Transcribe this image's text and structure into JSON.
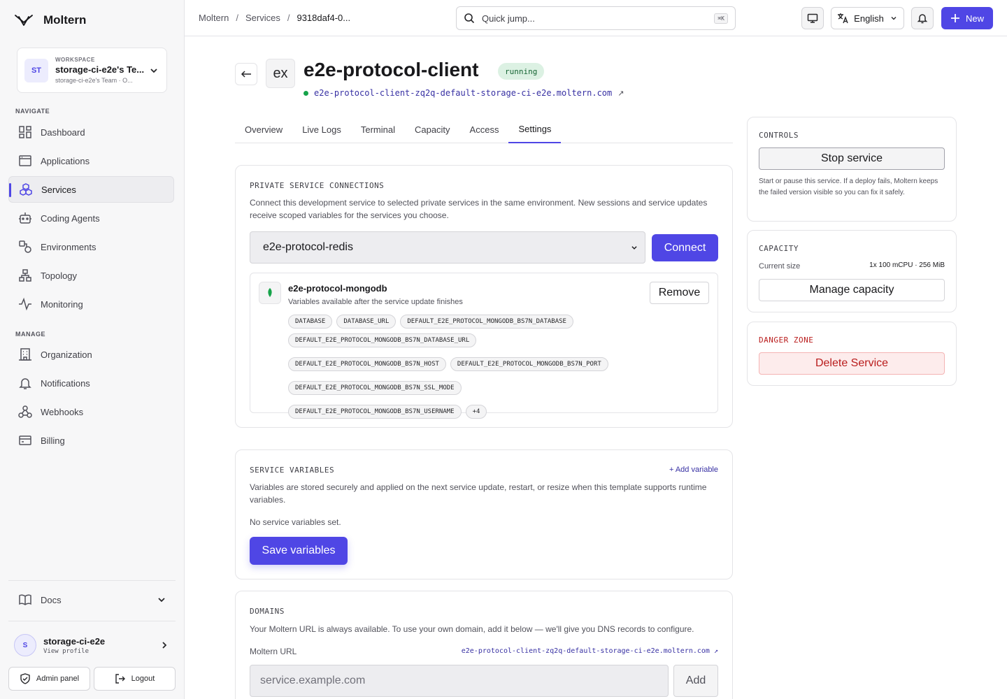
{
  "brand": {
    "name": "Moltern"
  },
  "workspace": {
    "kicker": "WORKSPACE",
    "initials": "ST",
    "name": "storage-ci-e2e's Te...",
    "sub": "storage-ci-e2e's Team · O..."
  },
  "nav": {
    "navigate_label": "NAVIGATE",
    "manage_label": "MANAGE",
    "items": [
      {
        "label": "Dashboard"
      },
      {
        "label": "Applications"
      },
      {
        "label": "Services"
      },
      {
        "label": "Coding Agents"
      },
      {
        "label": "Environments"
      },
      {
        "label": "Topology"
      },
      {
        "label": "Monitoring"
      }
    ],
    "manage_items": [
      {
        "label": "Organization"
      },
      {
        "label": "Notifications"
      },
      {
        "label": "Webhooks"
      },
      {
        "label": "Billing"
      }
    ],
    "docs_label": "Docs"
  },
  "user": {
    "initial": "S",
    "name": "storage-ci-e2e",
    "sub": "View profile"
  },
  "footer": {
    "admin_label": "Admin panel",
    "logout_label": "Logout"
  },
  "topbar": {
    "crumbs": [
      "Moltern",
      "Services",
      "9318daf4-0..."
    ],
    "search_placeholder": "Quick jump...",
    "search_kbd": "⌘K",
    "language": "English",
    "new_label": "New"
  },
  "header": {
    "icon_text": "ex",
    "title": "e2e-protocol-client",
    "status": "running",
    "url": "e2e-protocol-client-zq2q-default-storage-ci-e2e.moltern.com",
    "ext_arrow": "↗"
  },
  "tabs": [
    "Overview",
    "Live Logs",
    "Terminal",
    "Capacity",
    "Access",
    "Settings"
  ],
  "private_connections": {
    "label": "PRIVATE SERVICE CONNECTIONS",
    "desc": "Connect this development service to selected private services in the same environment. New sessions and service updates receive scoped variables for the services you choose.",
    "selected": "e2e-protocol-redis",
    "connect_label": "Connect",
    "item": {
      "name": "e2e-protocol-mongodb",
      "sub": "Variables available after the service update finishes",
      "remove_label": "Remove",
      "vars": [
        "DATABASE",
        "DATABASE_URL",
        "DEFAULT_E2E_PROTOCOL_MONGODB_BS7N_DATABASE",
        "DEFAULT_E2E_PROTOCOL_MONGODB_BS7N_DATABASE_URL",
        "DEFAULT_E2E_PROTOCOL_MONGODB_BS7N_HOST",
        "DEFAULT_E2E_PROTOCOL_MONGODB_BS7N_PORT",
        "DEFAULT_E2E_PROTOCOL_MONGODB_BS7N_SSL_MODE",
        "DEFAULT_E2E_PROTOCOL_MONGODB_BS7N_USERNAME",
        "+4"
      ]
    }
  },
  "service_variables": {
    "label": "SERVICE VARIABLES",
    "add_label": "+ Add variable",
    "desc": "Variables are stored securely and applied on the next service update, restart, or resize when this template supports runtime variables.",
    "empty": "No service variables set.",
    "save_label": "Save variables"
  },
  "domains": {
    "label": "DOMAINS",
    "desc": "Your Moltern URL is always available. To use your own domain, add it below — we'll give you DNS records to configure.",
    "url_label": "Moltern URL",
    "url": "e2e-protocol-client-zq2q-default-storage-ci-e2e.moltern.com ↗",
    "input_placeholder": "service.example.com",
    "add_label": "Add"
  },
  "controls": {
    "label": "CONTROLS",
    "stop_label": "Stop service",
    "desc": "Start or pause this service. If a deploy fails, Moltern keeps the failed version visible so you can fix it safely."
  },
  "capacity": {
    "label": "CAPACITY",
    "current_label": "Current size",
    "current_value": "1x 100 mCPU · 256 MiB",
    "manage_label": "Manage capacity"
  },
  "danger": {
    "label": "DANGER ZONE",
    "delete_label": "Delete Service"
  },
  "colors": {
    "accent": "#4f46e5",
    "danger": "#b91c1c",
    "running_bg": "#dcf1e3"
  }
}
